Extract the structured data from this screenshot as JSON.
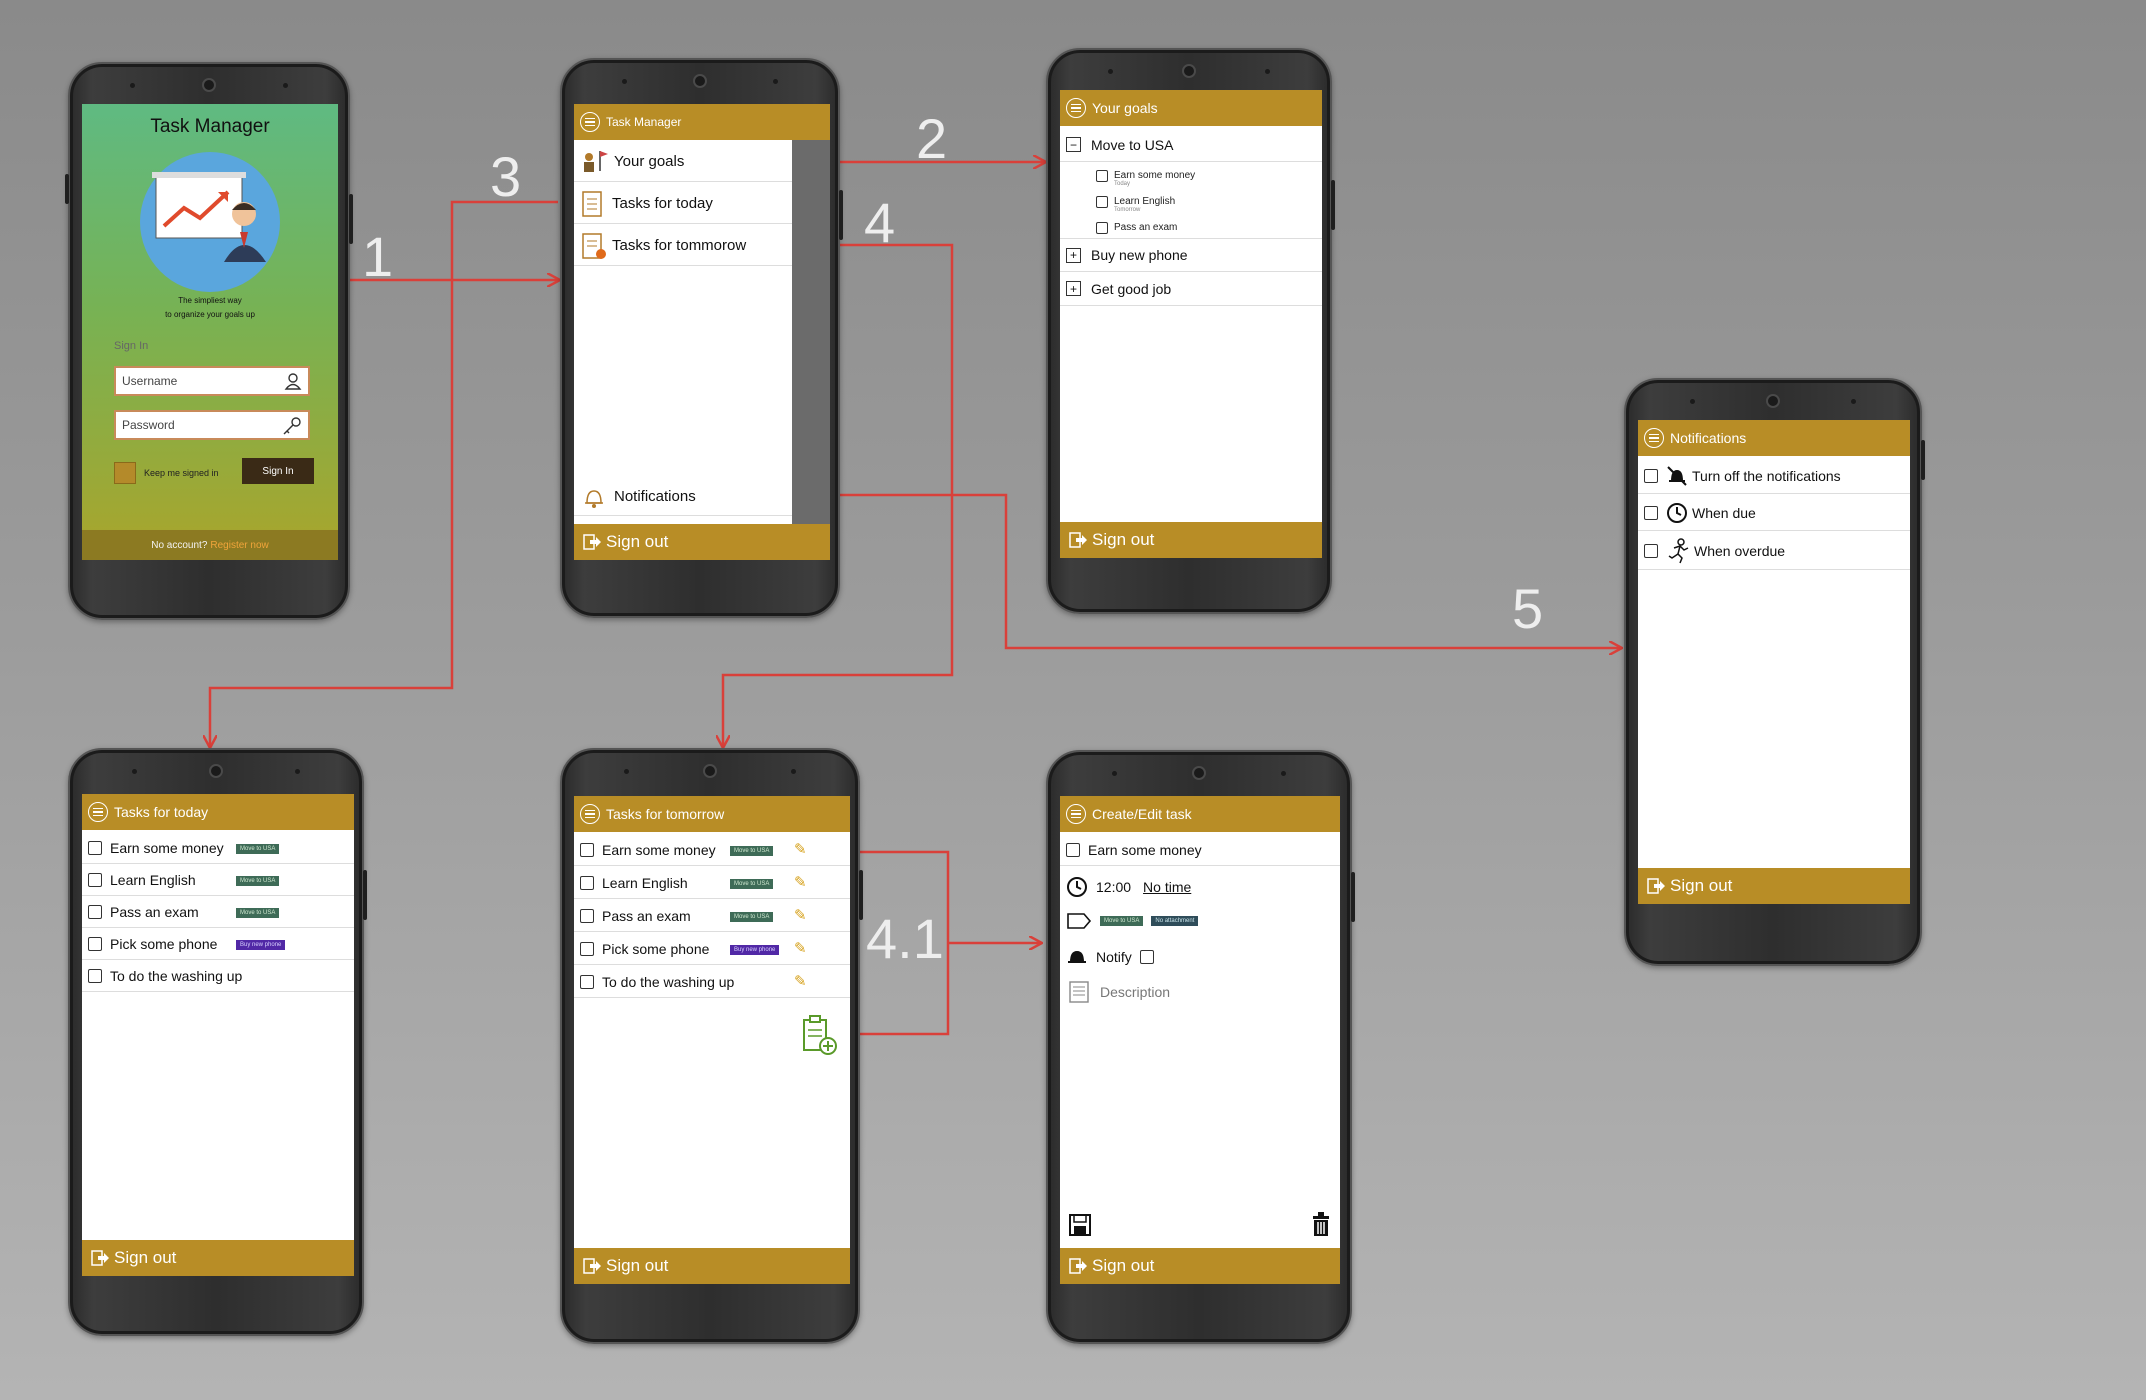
{
  "colors": {
    "accent": "#b88d26",
    "arrow": "#d9403a",
    "tag_green": "#3e6b57",
    "tag_purple": "#5128a6"
  },
  "flow_labels": [
    "1",
    "2",
    "3",
    "4",
    "4.1",
    "5"
  ],
  "login": {
    "title": "Task Manager",
    "tagline_1": "The simpliest way",
    "tagline_2": "to organize your goals up",
    "sign_in_heading": "Sign In",
    "username_placeholder": "Username",
    "password_placeholder": "Password",
    "keep_signed": "Keep me signed in",
    "sign_in_button": "Sign In",
    "no_account": "No account?",
    "register": "Register now"
  },
  "menu": {
    "title": "Task Manager",
    "items": [
      {
        "label": "Your goals",
        "icon": "goals-icon"
      },
      {
        "label": "Tasks for today",
        "icon": "checklist-icon"
      },
      {
        "label": "Tasks for tommorow",
        "icon": "checklist-clock-icon"
      }
    ],
    "notifications": "Notifications",
    "sign_out": "Sign out"
  },
  "goals": {
    "title": "Your goals",
    "groups": [
      {
        "label": "Move to USA",
        "expanded": true,
        "subtasks": [
          {
            "label": "Earn some money",
            "due": "Today"
          },
          {
            "label": "Learn English",
            "due": "Tomorrow"
          },
          {
            "label": "Pass an exam",
            "due": ""
          }
        ]
      },
      {
        "label": "Buy new phone",
        "expanded": false
      },
      {
        "label": "Get good job",
        "expanded": false
      }
    ],
    "sign_out": "Sign out"
  },
  "notifications": {
    "title": "Notifications",
    "items": [
      {
        "label": "Turn off the notifications",
        "icon": "bell-off-icon"
      },
      {
        "label": "When due",
        "icon": "clock-icon"
      },
      {
        "label": "When overdue",
        "icon": "running-person-icon"
      }
    ],
    "sign_out": "Sign out"
  },
  "today": {
    "title": "Tasks for today",
    "tasks": [
      {
        "label": "Earn some money",
        "tag": "Move to USA"
      },
      {
        "label": "Learn English",
        "tag": "Move to USA"
      },
      {
        "label": "Pass an exam",
        "tag": "Move to USA"
      },
      {
        "label": "Pick some phone",
        "tag": "Buy new phone"
      },
      {
        "label": "To do the washing up",
        "tag": ""
      }
    ],
    "sign_out": "Sign out"
  },
  "tomorrow": {
    "title": "Tasks for tomorrow",
    "tasks": [
      {
        "label": "Earn some money",
        "tag": "Move to USA"
      },
      {
        "label": "Learn English",
        "tag": "Move to USA"
      },
      {
        "label": "Pass an exam",
        "tag": "Move to USA"
      },
      {
        "label": "Pick some phone",
        "tag": "Buy new phone"
      },
      {
        "label": "To do the washing up",
        "tag": ""
      }
    ],
    "sign_out": "Sign out"
  },
  "edit": {
    "title": "Create/Edit task",
    "task_name": "Earn some money",
    "time": "12:00",
    "no_time": "No time",
    "tag_goal": "Move to USA",
    "tag_attachment": "No attachment",
    "notify": "Notify",
    "description_placeholder": "Description",
    "sign_out": "Sign out"
  }
}
